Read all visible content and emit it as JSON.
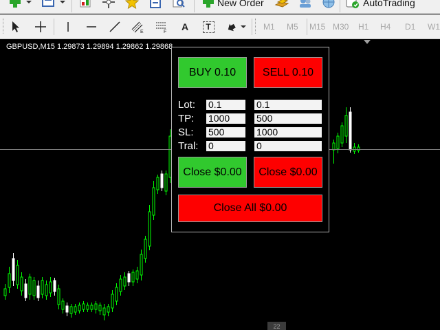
{
  "toolbar_top": {
    "new_order_label": "New Order",
    "autotrading_label": "AutoTrading"
  },
  "toolbar_tools": {
    "text_tool": "A",
    "label_tool": "T"
  },
  "timeframes": [
    "M1",
    "M5",
    "M15",
    "M30",
    "H1",
    "H4",
    "D1",
    "W1"
  ],
  "chart": {
    "symbol_info": "GBPUSD,M15  1.29873 1.29894 1.29862 1.29868",
    "bottom_tag": "22",
    "bull_color": "#00ff00",
    "bear_color": "#ffffff",
    "background": "#000000"
  },
  "panel": {
    "buy_button": "BUY 0.10",
    "sell_button": "SELL 0.10",
    "labels": {
      "lot": "Lot:",
      "tp": "TP:",
      "sl": "SL:",
      "tral": "Tral:"
    },
    "buy_fields": {
      "lot": "0.1",
      "tp": "1000",
      "sl": "500",
      "tral": "0"
    },
    "sell_fields": {
      "lot": "0.1",
      "tp": "500",
      "sl": "1000",
      "tral": "0"
    },
    "close_buy_button": "Close $0.00",
    "close_sell_button": "Close $0.00",
    "close_all_button": "Close All $0.00",
    "buy_color": "#31c92e",
    "sell_color": "#fe0000"
  }
}
